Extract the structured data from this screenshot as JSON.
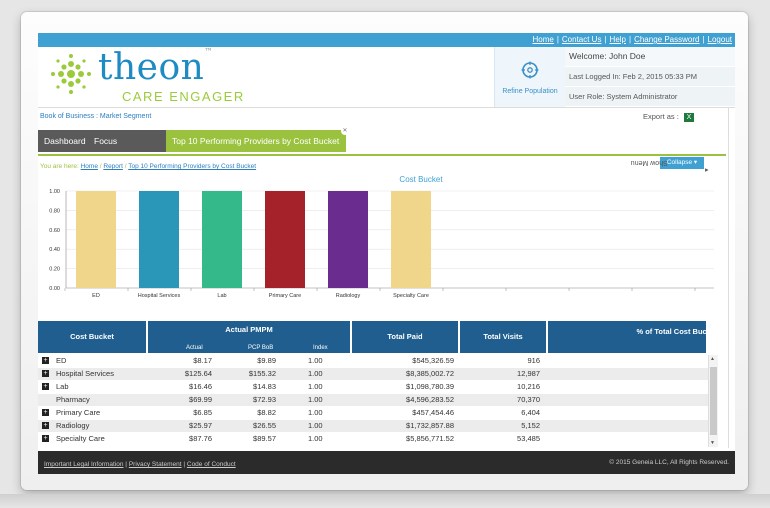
{
  "topbar": {
    "links": [
      "Home",
      "Contact Us",
      "Help",
      "Change Password",
      "Logout"
    ]
  },
  "header": {
    "brand": "theon",
    "tagline": "CARE ENGAGER",
    "refine_label": "Refine Population",
    "welcome": "Welcome: John Doe",
    "last_logged": "Last Logged In: Feb 2, 2015 05:33 PM",
    "user_role": "User Role: System Administrator"
  },
  "menubar": {
    "book_label": "Book of Business : Market Segment",
    "export_label": "Export as :"
  },
  "tabs": [
    {
      "label": "Dashboard"
    },
    {
      "label": "Focus Dashboard"
    },
    {
      "label": "Top 10 Performing Providers by Cost Bucket"
    }
  ],
  "breadcrumb": {
    "prefix": "You are here:",
    "items": [
      "Home",
      "Report",
      "Top 10 Performing Providers by Cost Bucket"
    ]
  },
  "collapse_label": "Collapse",
  "show_menu_label": "Show Menu",
  "chart_data": {
    "type": "bar",
    "title": "Cost Bucket",
    "categories": [
      "ED",
      "Hospital Services",
      "Lab",
      "Primary Care",
      "Radiology",
      "Specialty Care"
    ],
    "values": [
      1.0,
      1.0,
      1.0,
      1.0,
      1.0,
      1.0
    ],
    "colors": [
      "#f0d68a",
      "#2a97b8",
      "#33b98a",
      "#a6222a",
      "#6a2c8e",
      "#f0d68a"
    ],
    "yticks": [
      "0.00",
      "0.20",
      "0.40",
      "0.60",
      "0.80",
      "1.00"
    ],
    "ylim": [
      0,
      1.0
    ],
    "grid": true
  },
  "table": {
    "headers": {
      "cost_bucket": "Cost Bucket",
      "actual_pmpm": "Actual PMPM",
      "actual": "Actual",
      "pcp_bob": "PCP BoB",
      "index": "Index",
      "total_paid": "Total Paid",
      "total_visits": "Total Visits",
      "pct_total": "% of Total Cost Bucket"
    },
    "rows": [
      {
        "expand": true,
        "name": "ED",
        "actual": "$8.17",
        "pcp": "$9.89",
        "index": "1.00",
        "paid": "$545,326.59",
        "visits": "916"
      },
      {
        "expand": true,
        "name": "Hospital Services",
        "actual": "$125.64",
        "pcp": "$155.32",
        "index": "1.00",
        "paid": "$8,385,002.72",
        "visits": "12,987"
      },
      {
        "expand": true,
        "name": "Lab",
        "actual": "$16.46",
        "pcp": "$14.83",
        "index": "1.00",
        "paid": "$1,098,780.39",
        "visits": "10,216"
      },
      {
        "expand": false,
        "name": "Pharmacy",
        "actual": "$69.99",
        "pcp": "$72.93",
        "index": "1.00",
        "paid": "$4,596,283.52",
        "visits": "70,370"
      },
      {
        "expand": true,
        "name": "Primary Care",
        "actual": "$6.85",
        "pcp": "$8.82",
        "index": "1.00",
        "paid": "$457,454.46",
        "visits": "6,404"
      },
      {
        "expand": true,
        "name": "Radiology",
        "actual": "$25.97",
        "pcp": "$26.55",
        "index": "1.00",
        "paid": "$1,732,857.88",
        "visits": "5,152"
      },
      {
        "expand": true,
        "name": "Specialty Care",
        "actual": "$87.76",
        "pcp": "$89.57",
        "index": "1.00",
        "paid": "$5,856,771.52",
        "visits": "53,485"
      }
    ]
  },
  "footer": {
    "links": [
      "Important Legal Information",
      "Privacy Statement",
      "Code of Conduct"
    ],
    "copyright": "© 2015 Geneia LLC, All Rights Reserved."
  }
}
